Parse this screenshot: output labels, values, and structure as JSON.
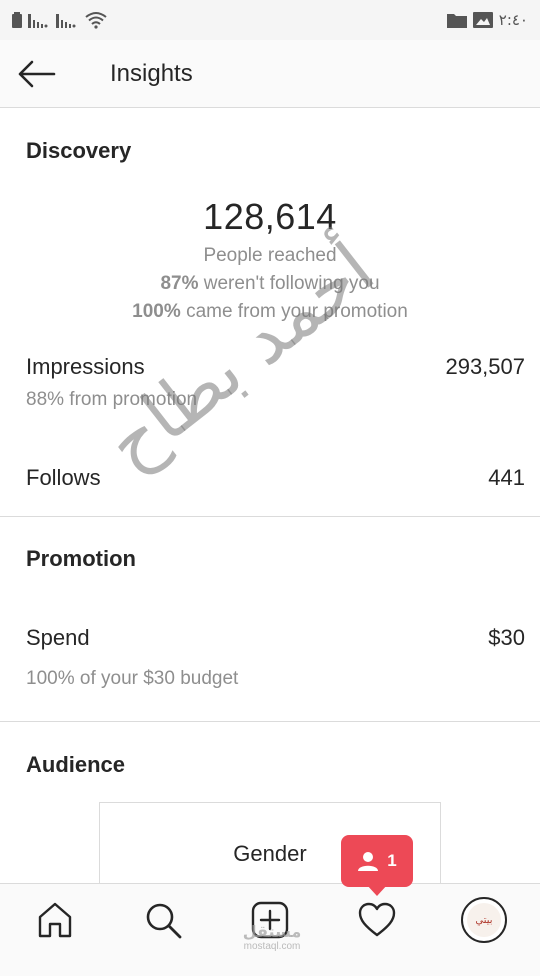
{
  "status_bar": {
    "time": "٢:٤٠",
    "icons": [
      "battery-icon",
      "signal-icon",
      "signal-icon",
      "wifi-icon",
      "folder-icon",
      "image-icon"
    ]
  },
  "header": {
    "title": "Insights",
    "back_icon": "back-arrow-icon"
  },
  "discovery": {
    "title": "Discovery",
    "reach_value": "128,614",
    "reach_label": "People reached",
    "not_following_pct": "87%",
    "not_following_text": "weren't following you",
    "promotion_pct": "100%",
    "promotion_text": "came from your promotion",
    "impressions_label": "Impressions",
    "impressions_value": "293,507",
    "impressions_sub": "88% from promotion",
    "follows_label": "Follows",
    "follows_value": "441"
  },
  "promotion": {
    "title": "Promotion",
    "spend_label": "Spend",
    "spend_value": "$30",
    "spend_sub": "100% of your $30 budget"
  },
  "audience": {
    "title": "Audience",
    "gender_label": "Gender"
  },
  "notification": {
    "icon": "person-icon",
    "count": "1",
    "color": "#ed4956"
  },
  "tab_bar": {
    "tabs": [
      "home-icon",
      "search-icon",
      "add-post-icon",
      "heart-icon",
      "profile-avatar"
    ],
    "avatar_text": "بيتي"
  },
  "watermark": {
    "text": "أحمد بطاح"
  },
  "site_mark": {
    "arabic": "مستقل",
    "latin": "mostaql.com"
  }
}
